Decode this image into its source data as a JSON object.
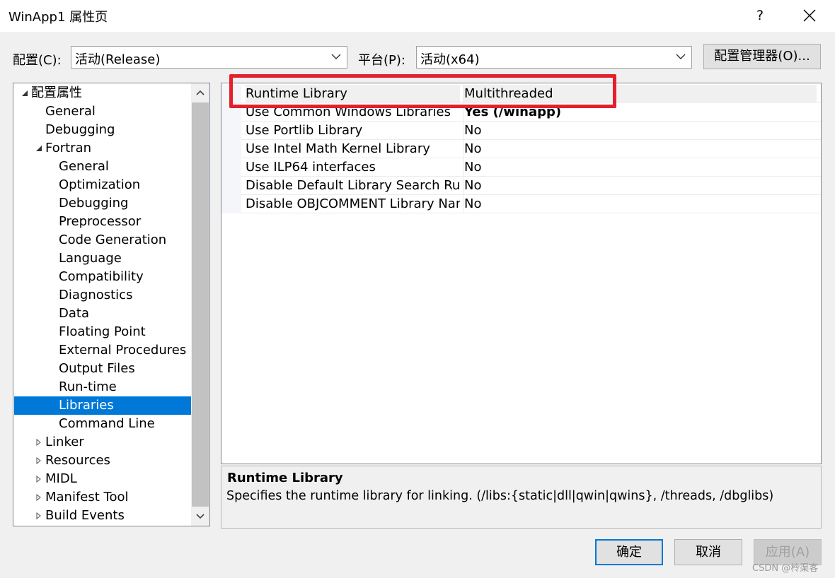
{
  "window": {
    "title": "WinApp1 属性页",
    "help": "?"
  },
  "toolbar": {
    "config_label": "配置(C):",
    "config_value": "活动(Release)",
    "platform_label": "平台(P):",
    "platform_value": "活动(x64)",
    "config_manager": "配置管理器(O)..."
  },
  "tree": [
    {
      "label": "配置属性",
      "expander": "expanded",
      "level": 0
    },
    {
      "label": "General",
      "expander": "none",
      "level": 1
    },
    {
      "label": "Debugging",
      "expander": "none",
      "level": 1
    },
    {
      "label": "Fortran",
      "expander": "expanded",
      "level": 1
    },
    {
      "label": "General",
      "expander": "none",
      "level": 2
    },
    {
      "label": "Optimization",
      "expander": "none",
      "level": 2
    },
    {
      "label": "Debugging",
      "expander": "none",
      "level": 2
    },
    {
      "label": "Preprocessor",
      "expander": "none",
      "level": 2
    },
    {
      "label": "Code Generation",
      "expander": "none",
      "level": 2
    },
    {
      "label": "Language",
      "expander": "none",
      "level": 2
    },
    {
      "label": "Compatibility",
      "expander": "none",
      "level": 2
    },
    {
      "label": "Diagnostics",
      "expander": "none",
      "level": 2
    },
    {
      "label": "Data",
      "expander": "none",
      "level": 2
    },
    {
      "label": "Floating Point",
      "expander": "none",
      "level": 2
    },
    {
      "label": "External Procedures",
      "expander": "none",
      "level": 2
    },
    {
      "label": "Output Files",
      "expander": "none",
      "level": 2
    },
    {
      "label": "Run-time",
      "expander": "none",
      "level": 2
    },
    {
      "label": "Libraries",
      "expander": "none",
      "level": 2,
      "selected": true
    },
    {
      "label": "Command Line",
      "expander": "none",
      "level": 2
    },
    {
      "label": "Linker",
      "expander": "collapsed",
      "level": 1
    },
    {
      "label": "Resources",
      "expander": "collapsed",
      "level": 1
    },
    {
      "label": "MIDL",
      "expander": "collapsed",
      "level": 1
    },
    {
      "label": "Manifest Tool",
      "expander": "collapsed",
      "level": 1
    },
    {
      "label": "Build Events",
      "expander": "collapsed",
      "level": 1
    }
  ],
  "properties": [
    {
      "name": "Runtime Library",
      "value": "Multithreaded",
      "bold": false
    },
    {
      "name": "Use Common Windows Libraries",
      "value": "Yes (/winapp)",
      "bold": true
    },
    {
      "name": "Use Portlib Library",
      "value": "No",
      "bold": false
    },
    {
      "name": "Use Intel Math Kernel Library",
      "value": "No",
      "bold": false
    },
    {
      "name": "Use ILP64 interfaces",
      "value": "No",
      "bold": false
    },
    {
      "name": "Disable Default Library Search Rules",
      "value": "No",
      "bold": false
    },
    {
      "name": "Disable OBJCOMMENT Library Names",
      "value": "No",
      "bold": false
    }
  ],
  "description": {
    "title": "Runtime Library",
    "text": "Specifies the runtime library for linking. (/libs:{static|dll|qwin|qwins}, /threads, /dbglibs)"
  },
  "buttons": {
    "ok": "确定",
    "cancel": "取消",
    "apply": "应用(A)"
  },
  "watermark": "CSDN @柃渠客",
  "colors": {
    "selection": "#0078d7",
    "highlight_box": "#e3202b"
  }
}
